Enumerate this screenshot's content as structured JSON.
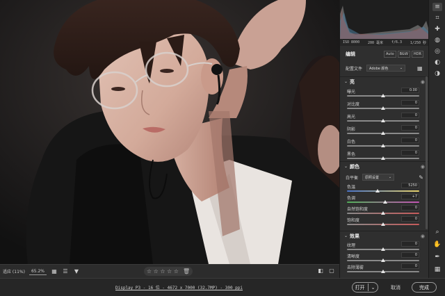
{
  "canvas_bar": {
    "zoom_fit": "适应 (11%)",
    "zoom_value": "65.2%",
    "stars": "☆ ☆ ☆ ☆ ☆"
  },
  "status": {
    "info": "Display P3 - 16 位 - 4672 x 7000 (32.7MP) - 300 ppi",
    "open_label": "打开",
    "cancel_label": "取消",
    "done_label": "完成"
  },
  "exif": {
    "iso": "ISO 8000",
    "focal": "200 毫米",
    "aperture": "f/6.3",
    "shutter": "1/250 秒"
  },
  "edit": {
    "title": "编辑",
    "modes": [
      "Auto",
      "B&W",
      "HDR"
    ],
    "profile_label": "配置文件",
    "profile_value": "Adobe 颜色"
  },
  "light": {
    "title": "亮",
    "sliders": [
      {
        "label": "曝光",
        "value": "0.00",
        "pos": 0.5
      },
      {
        "label": "对比度",
        "value": "0",
        "pos": 0.5
      },
      {
        "label": "高光",
        "value": "0",
        "pos": 0.5
      },
      {
        "label": "阴影",
        "value": "0",
        "pos": 0.5
      },
      {
        "label": "白色",
        "value": "0",
        "pos": 0.5
      },
      {
        "label": "黑色",
        "value": "0",
        "pos": 0.5
      }
    ]
  },
  "color": {
    "title": "颜色",
    "wb_label": "白平衡",
    "wb_value": "原照设置",
    "sliders": [
      {
        "label": "色温",
        "value": "5250",
        "pos": 0.42
      },
      {
        "label": "色调",
        "value": "+7",
        "pos": 0.53
      },
      {
        "label": "自然饱和度",
        "value": "0",
        "pos": 0.5
      },
      {
        "label": "饱和度",
        "value": "0",
        "pos": 0.5
      }
    ]
  },
  "effects": {
    "title": "效果",
    "sliders": [
      {
        "label": "纹理",
        "value": "0",
        "pos": 0.5
      },
      {
        "label": "清晰度",
        "value": "0",
        "pos": 0.5
      },
      {
        "label": "去除薄雾",
        "value": "0",
        "pos": 0.5
      }
    ]
  },
  "colors": {
    "panel_bg": "#2f2f2f",
    "canvas_bg": "#1b1b1b",
    "accent_text": "#ececec"
  }
}
